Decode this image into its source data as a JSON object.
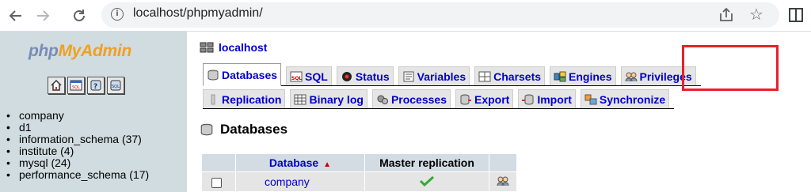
{
  "browser": {
    "url": "localhost/phpmyadmin/"
  },
  "sidebar": {
    "logo": {
      "php": "php",
      "myadmin": "MyAdmin"
    },
    "quick_icons": [
      "home-icon",
      "sql-query-icon",
      "docs-icon",
      "sql-docs-icon"
    ],
    "databases": [
      "company",
      "d1",
      "information_schema (37)",
      "institute (4)",
      "mysql (24)",
      "performance_schema (17)"
    ]
  },
  "main": {
    "server": "localhost",
    "tabs_row1": [
      {
        "label": "Databases",
        "icon": "databases-icon",
        "active": true
      },
      {
        "label": "SQL",
        "icon": "sql-icon"
      },
      {
        "label": "Status",
        "icon": "status-icon"
      },
      {
        "label": "Variables",
        "icon": "variables-icon"
      },
      {
        "label": "Charsets",
        "icon": "charsets-icon"
      },
      {
        "label": "Engines",
        "icon": "engines-icon"
      },
      {
        "label": "Privileges",
        "icon": "privileges-icon",
        "highlighted": true
      }
    ],
    "tabs_row2": [
      {
        "label": "Replication",
        "icon": "replication-icon"
      },
      {
        "label": "Binary log",
        "icon": "binary-log-icon"
      },
      {
        "label": "Processes",
        "icon": "processes-icon"
      },
      {
        "label": "Export",
        "icon": "export-icon"
      },
      {
        "label": "Import",
        "icon": "import-icon"
      },
      {
        "label": "Synchronize",
        "icon": "synchronize-icon"
      }
    ],
    "section_title": "Databases",
    "table": {
      "headers": [
        "Database",
        "Master replication"
      ],
      "sort_indicator": "▲",
      "rows": [
        {
          "database": "company",
          "master_replication": "check-icon"
        }
      ]
    },
    "highlight_color": "#e8202a"
  }
}
